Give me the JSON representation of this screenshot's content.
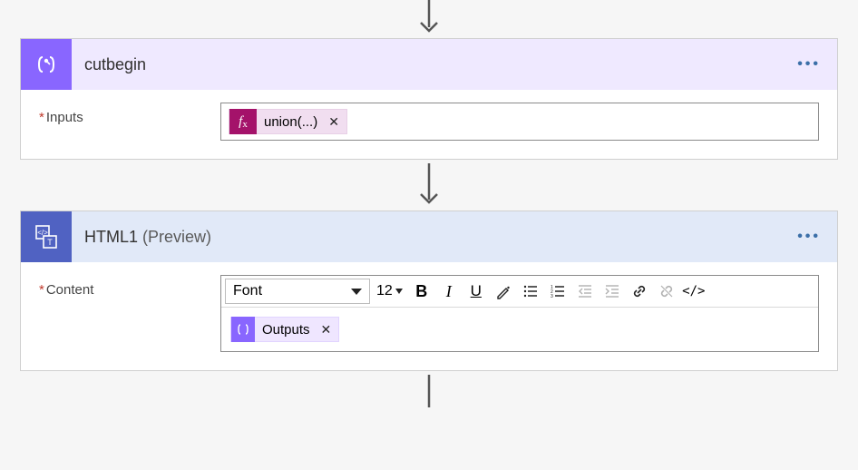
{
  "compose": {
    "title": "cutbegin",
    "inputs_label": "Inputs",
    "chip_text": "union(...)"
  },
  "html": {
    "title": "HTML1",
    "preview": "(Preview)",
    "content_label": "Content",
    "toolbar": {
      "font": "Font",
      "size": "12"
    },
    "token_text": "Outputs"
  }
}
